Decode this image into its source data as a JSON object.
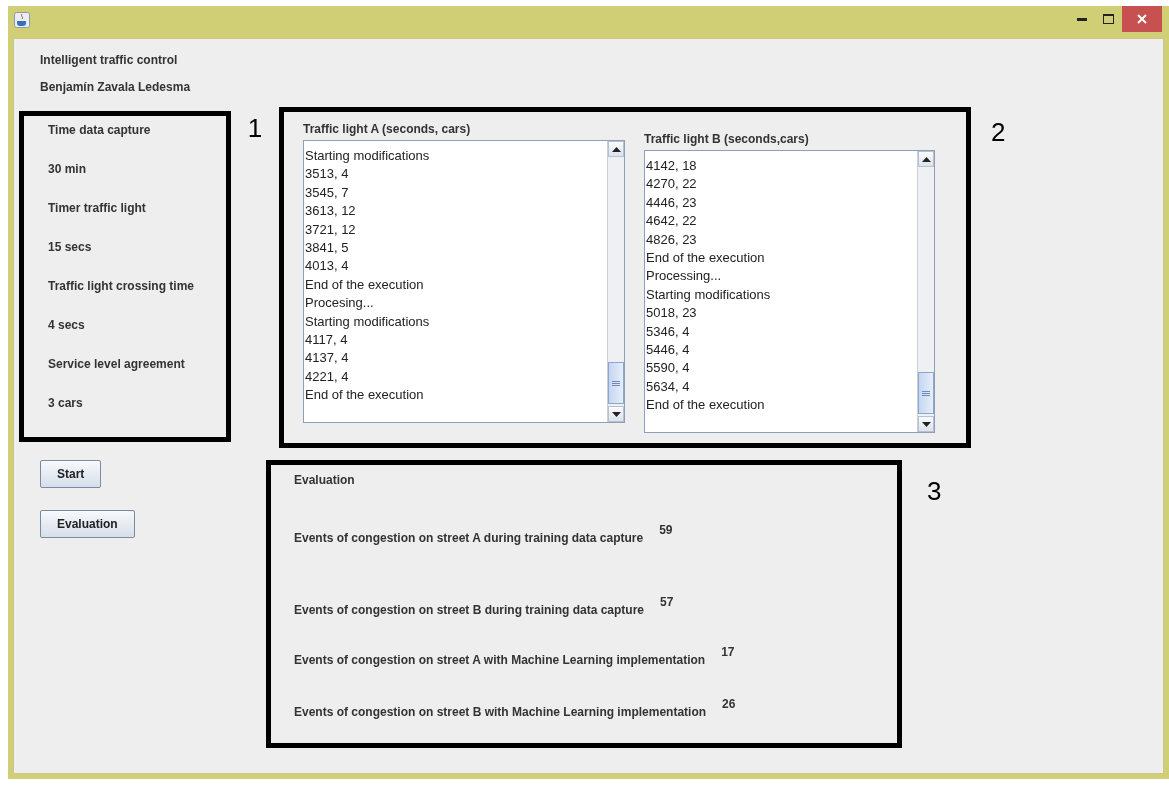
{
  "header": {
    "title": "Intelligent traffic control",
    "author": "Benjamín Zavala Ledesma"
  },
  "settings": [
    "Time data capture",
    "30 min",
    "Timer traffic light",
    "15 secs",
    "Traffic light crossing time",
    "4 secs",
    "Service level agreement",
    "3 cars"
  ],
  "buttons": [
    "Start",
    "Evaluation"
  ],
  "annotations": [
    "1",
    "2",
    "3"
  ],
  "lists": [
    {
      "label": "Traffic light A (seconds, cars)",
      "lines": [
        "Starting modifications",
        "3513, 4",
        "3545, 7",
        "3613, 12",
        "3721, 12",
        "3841, 5",
        "4013, 4",
        "End of the execution",
        "Procesing...",
        "Starting modifications",
        "4117, 4",
        "4137, 4",
        "4221, 4",
        "End of the execution"
      ]
    },
    {
      "label": "Traffic light B (seconds,cars)",
      "lines": [
        "4142, 18",
        "4270, 22",
        "4446, 23",
        "4642, 22",
        "4826, 23",
        "End of the execution",
        "Processing...",
        "Starting modifications",
        "5018, 23",
        "5346, 4",
        "5446, 4",
        "5590, 4",
        "5634, 4",
        "End of the execution"
      ]
    }
  ],
  "evaluation": {
    "title": "Evaluation",
    "rows": [
      {
        "label": "Events of congestion on street A during training data capture",
        "value": "59"
      },
      {
        "label": "Events of congestion on street B during training data capture",
        "value": "57"
      },
      {
        "label": "Events of congestion on street A with Machine Learning implementation",
        "value": "17"
      },
      {
        "label": "Events of congestion on street B with Machine Learning implementation",
        "value": "26"
      }
    ]
  }
}
